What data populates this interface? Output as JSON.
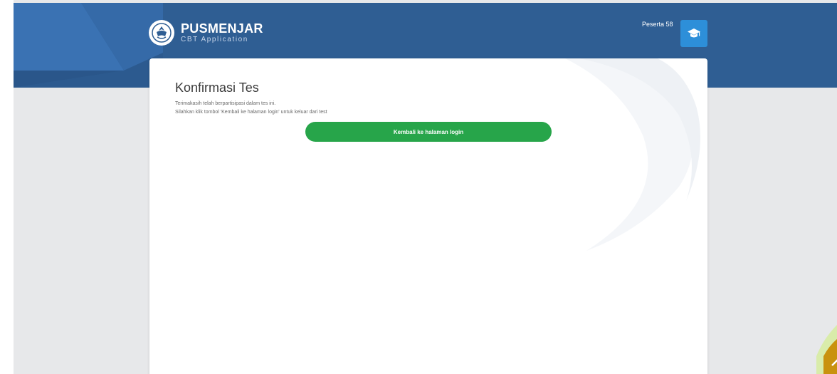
{
  "header": {
    "brand": "PUSMENJAR",
    "subtitle": "CBT Application",
    "user_name": "Peserta 58",
    "user_icon": "graduation-cap-icon",
    "logo_icon": "kemdikbud-emblem-icon"
  },
  "main": {
    "title": "Konfirmasi Tes",
    "message_line1": "Terimakasih telah berpartisipasi dalam tes ini.",
    "message_line2": "Silahkan klik tombol 'Kembali ke halaman login' untuk keluar dari test",
    "back_button_label": "Kembali ke halaman login"
  },
  "colors": {
    "header_bg": "#2f5e93",
    "page_bg": "#e7e8ea",
    "button_green": "#27a54a",
    "avatar_blue": "#2d8fd9"
  }
}
